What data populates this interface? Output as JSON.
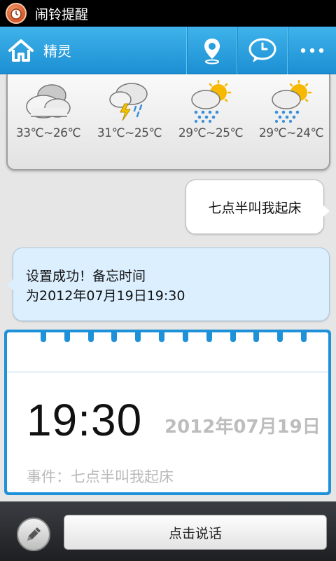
{
  "status_bar": {
    "app_icon": "alarm-clock-icon",
    "title": "闹铃提醒"
  },
  "top_bar": {
    "home_icon": "home-icon",
    "title": "精灵",
    "actions": [
      "location-pin-icon",
      "clock-chat-icon",
      "more-icon"
    ]
  },
  "weather": [
    {
      "icon": "cloudy-icon",
      "temp": "33℃~26℃"
    },
    {
      "icon": "thunderstorm-icon",
      "temp": "31℃~25℃"
    },
    {
      "icon": "sun-rain-icon",
      "temp": "29℃~25℃"
    },
    {
      "icon": "sun-rain-icon",
      "temp": "29℃~24℃"
    }
  ],
  "chat": {
    "user_message": "七点半叫我起床",
    "reply_line1": "设置成功！备忘时间",
    "reply_line2": "为2012年07月19日19:30"
  },
  "memo": {
    "time": "19:30",
    "date": "2012年07月19日",
    "event": "事件：七点半叫我起床"
  },
  "bottom_bar": {
    "edit_icon": "pencil-icon",
    "talk_label": "点击说话"
  },
  "colors": {
    "accent": "#1f91d8",
    "topbar": "#2a9fdd",
    "reply_bubble": "#dcefff"
  }
}
